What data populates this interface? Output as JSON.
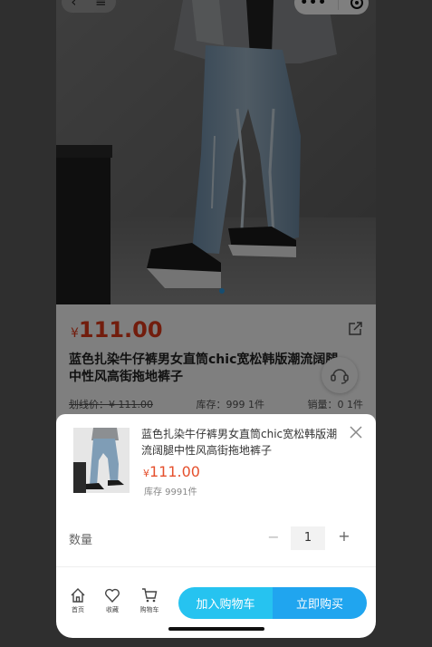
{
  "product": {
    "price_currency": "¥",
    "price": "111.00",
    "title": "蓝色扎染牛仔裤男女直筒chic宽松韩版潮流阔腿中性风高街拖地裤子",
    "original_price": "划线价：¥ 111.00",
    "stock": "库存：999 1件",
    "sales": "销量：0 1件"
  },
  "sheet": {
    "title": "蓝色扎染牛仔裤男女直筒chic宽松韩版潮流阔腿中性风高街拖地裤子",
    "price_currency": "¥",
    "price": "111.00",
    "stock": "库存 9991件",
    "qty_label": "数量",
    "qty_value": "1",
    "qty_minus": "−",
    "qty_plus": "+"
  },
  "bottom_nav": {
    "home": "首页",
    "favorite": "收藏",
    "cart": "购物车",
    "add_to_cart": "加入购物车",
    "buy_now": "立即购买"
  },
  "capsule": {
    "more": "•••"
  },
  "colors": {
    "price_red": "#e53b1a",
    "cart_blue": "#26c3f0",
    "buy_blue": "#20a5ef"
  },
  "icons": [
    "back-arrow-icon",
    "menu-icon",
    "more-icon",
    "target-icon",
    "share-icon",
    "customer-service-icon",
    "close-icon",
    "home-icon",
    "heart-icon",
    "cart-icon"
  ]
}
